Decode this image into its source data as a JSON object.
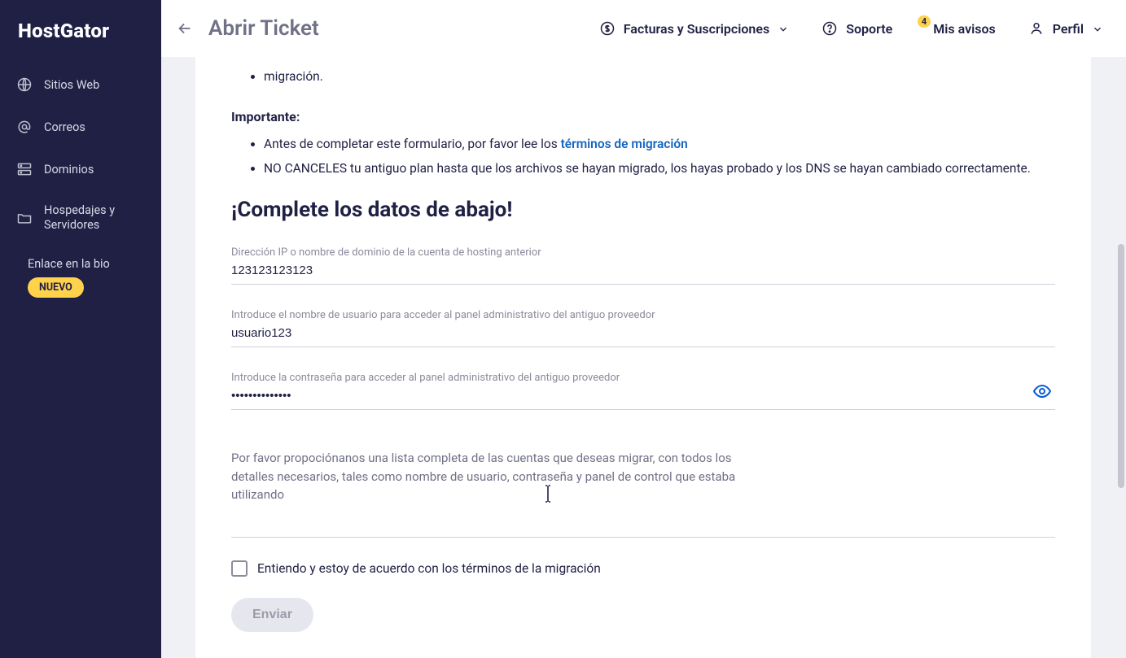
{
  "brand": {
    "name": "HostGator"
  },
  "sidebar": {
    "items": [
      {
        "label": "Sitios Web",
        "icon": "globe-icon"
      },
      {
        "label": "Correos",
        "icon": "at-icon"
      },
      {
        "label": "Dominios",
        "icon": "server-icon"
      },
      {
        "label": "Hospedajes y Servidores",
        "icon": "folder-icon"
      }
    ],
    "link_bio": {
      "label": "Enlace en la bio",
      "badge": "NUEVO",
      "icon": "link-icon"
    }
  },
  "header": {
    "page_title": "Abrir Ticket",
    "items": {
      "billing": "Facturas y Suscripciones",
      "support": "Soporte",
      "notices": "Mis avisos",
      "notices_count": "4",
      "profile": "Perfil"
    }
  },
  "content": {
    "trailing_sentence": "migración.",
    "important_label": "Importante:",
    "important_items": {
      "i0_prefix": "Antes de completar este formulario, por favor lee los ",
      "i0_link": "términos de migración",
      "i1": "NO CANCELES tu antiguo plan hasta que los archivos se hayan migrado, los hayas probado y los DNS se hayan cambiado correctamente."
    },
    "section_title": "¡Complete los datos de abajo!",
    "fields": {
      "ip": {
        "label": "Dirección IP o nombre de dominio de la cuenta de hosting anterior",
        "value": "123123123123"
      },
      "user": {
        "label": "Introduce el nombre de usuario para acceder al panel administrativo del antiguo proveedor",
        "value": "usuario123"
      },
      "password": {
        "label": "Introduce la contraseña para acceder al panel administrativo del antiguo proveedor",
        "value": "••••••••••••••"
      },
      "list_placeholder": "Por favor propociónanos una lista completa de las cuentas que deseas migrar, con todos los detalles necesarios, tales como nombre de usuario, contraseña y panel de control que estaba utilizando"
    },
    "agree_label": "Entiendo y estoy de acuerdo con los términos de la migración",
    "submit_label": "Enviar"
  }
}
